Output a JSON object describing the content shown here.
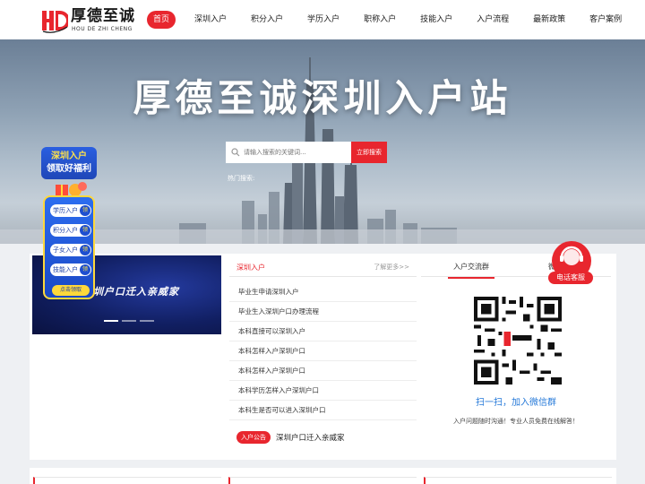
{
  "logo": {
    "name": "厚德至诚",
    "sub": "HOU DE ZHI CHENG"
  },
  "nav": [
    {
      "label": "首页",
      "active": true
    },
    {
      "label": "深圳入户"
    },
    {
      "label": "积分入户"
    },
    {
      "label": "学历入户"
    },
    {
      "label": "职称入户"
    },
    {
      "label": "技能入户"
    },
    {
      "label": "入户流程"
    },
    {
      "label": "最新政策"
    },
    {
      "label": "客户案例"
    }
  ],
  "hero": {
    "title": "厚德至诚深圳入户站",
    "search_placeholder": "请输入搜索的关键词...",
    "search_button": "立即搜索",
    "hot_label": "热门搜索:"
  },
  "float_left": {
    "title1": "深圳入户",
    "title2": "领取好福利",
    "items": [
      {
        "label": "学历入户",
        "tag": "领"
      },
      {
        "label": "积分入户",
        "tag": "领"
      },
      {
        "label": "子女入户",
        "tag": "领"
      },
      {
        "label": "技能入户",
        "tag": "领"
      }
    ],
    "button": "点击领取"
  },
  "banner": {
    "text": "深圳户口迁入亲威家"
  },
  "news": {
    "title": "深圳入户",
    "more": "了解更多>>",
    "items": [
      "毕业生申请深圳入户",
      "毕业生入深圳户口办理流程",
      "本科直接可以深圳入户",
      "本科怎样入户深圳户口",
      "本科怎样入户深圳户口",
      "本科学历怎样入户深圳户口",
      "本科生是否可以进入深圳户口"
    ],
    "notice_tag": "入户公告",
    "notice_text": "深圳户口迁入亲威家"
  },
  "qr": {
    "tab1": "入户交流群",
    "tab2": "微信客服",
    "caption": "扫一扫，加入微信群",
    "sub": "入户问题随时沟通！专业人员免费在线解答！"
  },
  "float_right": {
    "label": "电话客服"
  },
  "colors": {
    "accent": "#e8262e",
    "link": "#2478d8"
  }
}
